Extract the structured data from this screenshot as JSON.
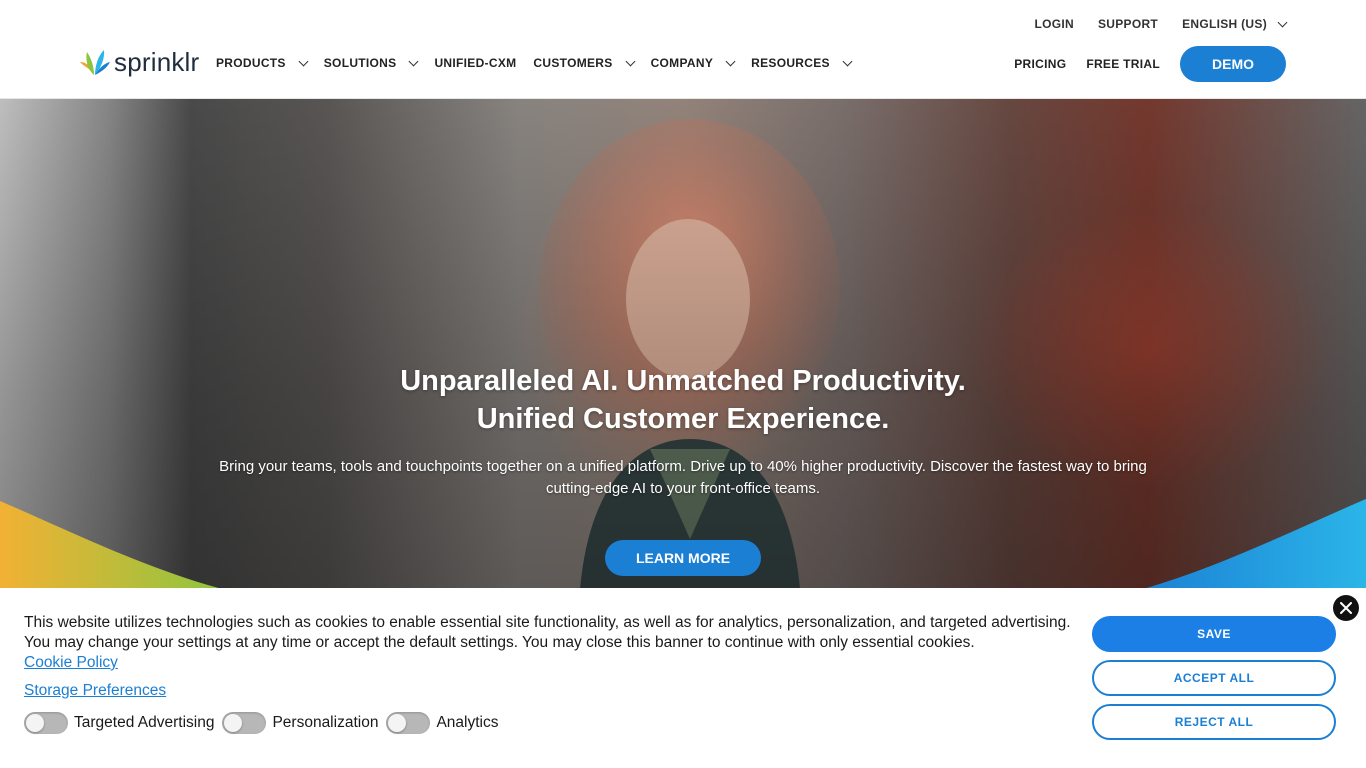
{
  "header": {
    "logo_text": "sprinklr",
    "util_nav": [
      "LOGIN",
      "SUPPORT",
      "ENGLISH (US)"
    ],
    "main_nav": [
      {
        "label": "PRODUCTS",
        "dropdown": true
      },
      {
        "label": "SOLUTIONS",
        "dropdown": true
      },
      {
        "label": "UNIFIED-CXM",
        "dropdown": false
      },
      {
        "label": "CUSTOMERS",
        "dropdown": true
      },
      {
        "label": "COMPANY",
        "dropdown": true
      },
      {
        "label": "RESOURCES",
        "dropdown": true
      }
    ],
    "pricing": "PRICING",
    "free_trial": "FREE TRIAL",
    "demo": "DEMO"
  },
  "hero": {
    "title_line1": "Unparalleled AI. Unmatched Productivity.",
    "title_line2": "Unified Customer Experience.",
    "subtitle": "Bring your teams, tools and touchpoints together on a unified platform. Drive up to 40% higher productivity. Discover the fastest way to bring cutting-edge AI to your front-office teams.",
    "cta": "LEARN MORE"
  },
  "cookie_banner": {
    "text": "This website utilizes technologies such as cookies to enable essential site functionality, as well as for analytics, personalization, and targeted advertising. You may change your settings at any time or accept the default settings. You may close this banner to continue with only essential cookies.",
    "cookie_policy_link": "Cookie Policy",
    "storage_preferences_link": "Storage Preferences",
    "toggles": [
      {
        "label": "Targeted Advertising",
        "on": false
      },
      {
        "label": "Personalization",
        "on": false
      },
      {
        "label": "Analytics",
        "on": false
      }
    ],
    "save": "SAVE",
    "accept_all": "ACCEPT ALL",
    "reject_all": "REJECT ALL"
  },
  "colors": {
    "accent": "#1b7fd4",
    "toggle_off": "#b7b7b7"
  }
}
